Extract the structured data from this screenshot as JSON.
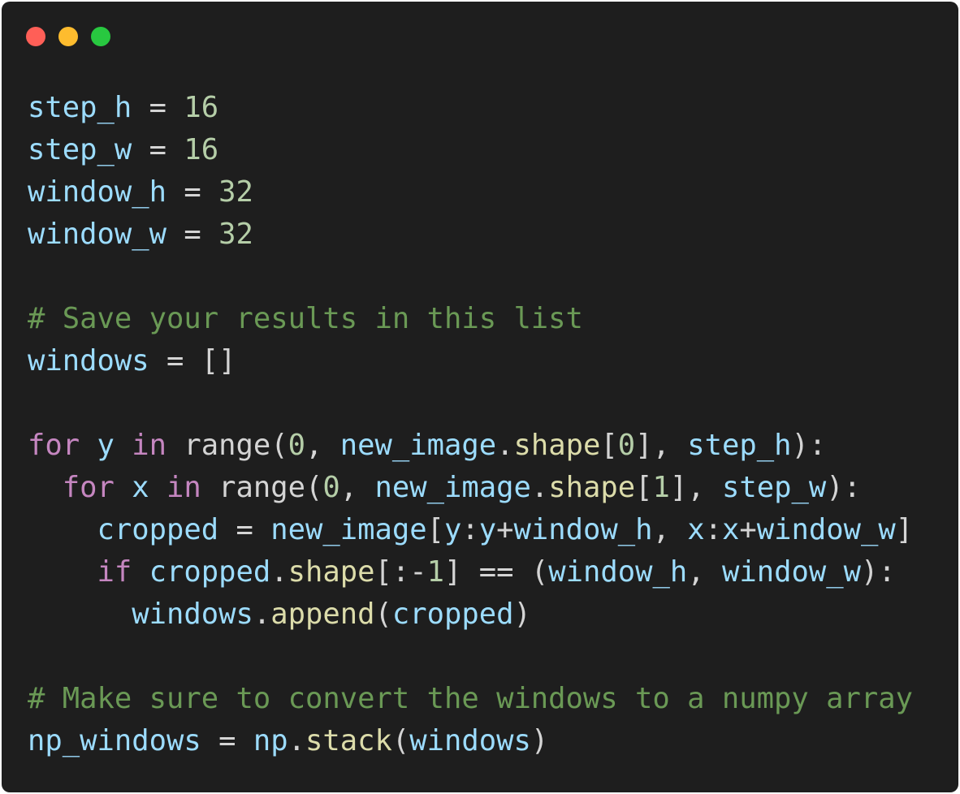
{
  "window": {
    "title_bar_buttons": [
      {
        "name": "close",
        "color": "#ff5f57"
      },
      {
        "name": "minimize",
        "color": "#febc2e"
      },
      {
        "name": "zoom",
        "color": "#28c840"
      }
    ],
    "background": "#1e1e1e"
  },
  "code": {
    "language": "python",
    "lines": [
      [
        {
          "t": "step_h",
          "c": "var"
        },
        {
          "t": " = ",
          "c": "op"
        },
        {
          "t": "16",
          "c": "num"
        }
      ],
      [
        {
          "t": "step_w",
          "c": "var"
        },
        {
          "t": " = ",
          "c": "op"
        },
        {
          "t": "16",
          "c": "num"
        }
      ],
      [
        {
          "t": "window_h",
          "c": "var"
        },
        {
          "t": " = ",
          "c": "op"
        },
        {
          "t": "32",
          "c": "num"
        }
      ],
      [
        {
          "t": "window_w",
          "c": "var"
        },
        {
          "t": " = ",
          "c": "op"
        },
        {
          "t": "32",
          "c": "num"
        }
      ],
      [],
      [
        {
          "t": "# Save your results in this list",
          "c": "comment"
        }
      ],
      [
        {
          "t": "windows",
          "c": "var"
        },
        {
          "t": " = []",
          "c": "op"
        }
      ],
      [],
      [
        {
          "t": "for",
          "c": "kw"
        },
        {
          "t": " ",
          "c": "plain"
        },
        {
          "t": "y",
          "c": "var"
        },
        {
          "t": " ",
          "c": "plain"
        },
        {
          "t": "in",
          "c": "kw"
        },
        {
          "t": " range(",
          "c": "plain"
        },
        {
          "t": "0",
          "c": "num"
        },
        {
          "t": ", ",
          "c": "plain"
        },
        {
          "t": "new_image",
          "c": "var"
        },
        {
          "t": ".",
          "c": "plain"
        },
        {
          "t": "shape",
          "c": "fn"
        },
        {
          "t": "[",
          "c": "plain"
        },
        {
          "t": "0",
          "c": "num"
        },
        {
          "t": "], ",
          "c": "plain"
        },
        {
          "t": "step_h",
          "c": "var"
        },
        {
          "t": "):",
          "c": "plain"
        }
      ],
      [
        {
          "t": "  ",
          "c": "plain"
        },
        {
          "t": "for",
          "c": "kw"
        },
        {
          "t": " ",
          "c": "plain"
        },
        {
          "t": "x",
          "c": "var"
        },
        {
          "t": " ",
          "c": "plain"
        },
        {
          "t": "in",
          "c": "kw"
        },
        {
          "t": " range(",
          "c": "plain"
        },
        {
          "t": "0",
          "c": "num"
        },
        {
          "t": ", ",
          "c": "plain"
        },
        {
          "t": "new_image",
          "c": "var"
        },
        {
          "t": ".",
          "c": "plain"
        },
        {
          "t": "shape",
          "c": "fn"
        },
        {
          "t": "[",
          "c": "plain"
        },
        {
          "t": "1",
          "c": "num"
        },
        {
          "t": "], ",
          "c": "plain"
        },
        {
          "t": "step_w",
          "c": "var"
        },
        {
          "t": "):",
          "c": "plain"
        }
      ],
      [
        {
          "t": "    ",
          "c": "plain"
        },
        {
          "t": "cropped",
          "c": "var"
        },
        {
          "t": " = ",
          "c": "op"
        },
        {
          "t": "new_image",
          "c": "var"
        },
        {
          "t": "[",
          "c": "plain"
        },
        {
          "t": "y",
          "c": "var"
        },
        {
          "t": ":",
          "c": "plain"
        },
        {
          "t": "y",
          "c": "var"
        },
        {
          "t": "+",
          "c": "plain"
        },
        {
          "t": "window_h",
          "c": "var"
        },
        {
          "t": ", ",
          "c": "plain"
        },
        {
          "t": "x",
          "c": "var"
        },
        {
          "t": ":",
          "c": "plain"
        },
        {
          "t": "x",
          "c": "var"
        },
        {
          "t": "+",
          "c": "plain"
        },
        {
          "t": "window_w",
          "c": "var"
        },
        {
          "t": "]",
          "c": "plain"
        }
      ],
      [
        {
          "t": "    ",
          "c": "plain"
        },
        {
          "t": "if",
          "c": "kw"
        },
        {
          "t": " ",
          "c": "plain"
        },
        {
          "t": "cropped",
          "c": "var"
        },
        {
          "t": ".",
          "c": "plain"
        },
        {
          "t": "shape",
          "c": "fn"
        },
        {
          "t": "[:-",
          "c": "plain"
        },
        {
          "t": "1",
          "c": "num"
        },
        {
          "t": "] == (",
          "c": "plain"
        },
        {
          "t": "window_h",
          "c": "var"
        },
        {
          "t": ", ",
          "c": "plain"
        },
        {
          "t": "window_w",
          "c": "var"
        },
        {
          "t": "):",
          "c": "plain"
        }
      ],
      [
        {
          "t": "      ",
          "c": "plain"
        },
        {
          "t": "windows",
          "c": "var"
        },
        {
          "t": ".",
          "c": "plain"
        },
        {
          "t": "append",
          "c": "fn"
        },
        {
          "t": "(",
          "c": "plain"
        },
        {
          "t": "cropped",
          "c": "var"
        },
        {
          "t": ")",
          "c": "plain"
        }
      ],
      [],
      [
        {
          "t": "# Make sure to convert the windows to a numpy array",
          "c": "comment"
        }
      ],
      [
        {
          "t": "np_windows",
          "c": "var"
        },
        {
          "t": " = ",
          "c": "op"
        },
        {
          "t": "np",
          "c": "var"
        },
        {
          "t": ".",
          "c": "plain"
        },
        {
          "t": "stack",
          "c": "fn"
        },
        {
          "t": "(",
          "c": "plain"
        },
        {
          "t": "windows",
          "c": "var"
        },
        {
          "t": ")",
          "c": "plain"
        }
      ]
    ]
  }
}
